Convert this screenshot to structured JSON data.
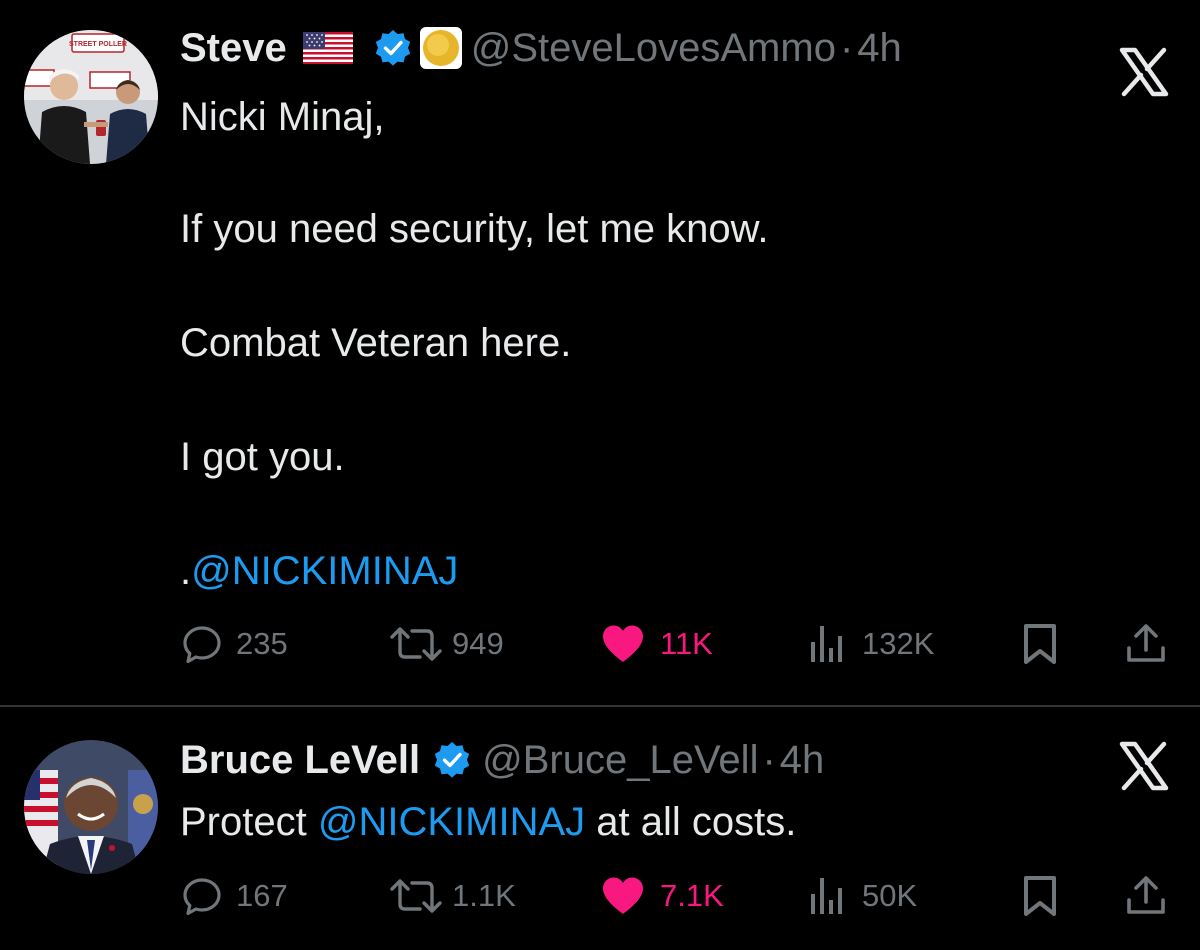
{
  "tweets": [
    {
      "name": "Steve",
      "handle": "@SteveLovesAmmo",
      "dot": "·",
      "time": "4h",
      "lines": [
        "Nicki Minaj,",
        "If you need security, let me know.",
        "Combat Veteran here.",
        "I got you."
      ],
      "mention_prefix": ".",
      "mention": "@NICKIMINAJ",
      "stats": {
        "replies": "235",
        "reposts": "949",
        "likes": "11K",
        "views": "132K"
      },
      "avatar_sign_text": "STREET POLLER"
    },
    {
      "name": "Bruce LeVell",
      "handle": "@Bruce_LeVell",
      "dot": "·",
      "time": "4h",
      "text_before": "Protect ",
      "mention": "@NICKIMINAJ",
      "text_after": " at all costs.",
      "stats": {
        "replies": "167",
        "reposts": "1.1K",
        "likes": "7.1K",
        "views": "50K"
      }
    }
  ],
  "colors": {
    "background": "#000000",
    "text": "#e7e9ea",
    "secondary": "#71767b",
    "mention": "#1d9bf0",
    "like": "#f91880",
    "verified": "#1d9bf0",
    "divider": "#2f3336"
  },
  "icons": [
    "us-flag-icon",
    "verified-badge-icon",
    "gold-circle-badge-icon",
    "x-logo-icon",
    "reply-icon",
    "repost-icon",
    "like-icon",
    "views-icon",
    "bookmark-icon",
    "share-icon"
  ]
}
